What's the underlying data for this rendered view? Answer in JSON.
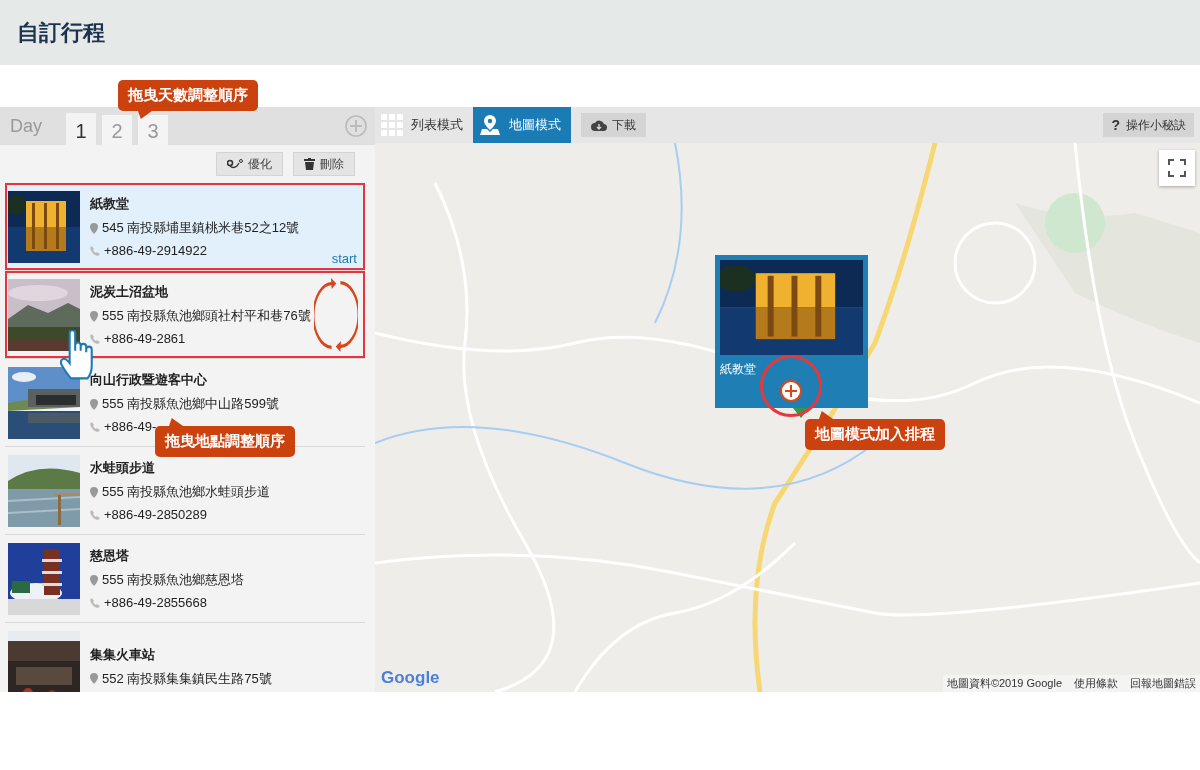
{
  "header": {
    "title": "自訂行程"
  },
  "days": {
    "label": "Day",
    "tabs": [
      {
        "label": "1",
        "selected": true
      },
      {
        "label": "2",
        "selected": false
      },
      {
        "label": "3",
        "selected": false
      }
    ]
  },
  "list_tools": [
    {
      "kind": "optimize",
      "label": "優化"
    },
    {
      "kind": "delete",
      "label": "刪除"
    }
  ],
  "places": [
    {
      "name": "紙教堂",
      "address": "545 南投縣埔里鎮桃米巷52之12號",
      "phone": "+886-49-2914922",
      "selected": true,
      "highlighted": true,
      "badge": "start"
    },
    {
      "name": "泥炭土沼盆地",
      "address": "555 南投縣魚池鄉頭社村平和巷76號",
      "phone": "+886-49-2861",
      "selected": false,
      "highlighted": true
    },
    {
      "name": "向山行政暨遊客中心",
      "address": "555 南投縣魚池鄉中山路599號",
      "phone": "+886-49-",
      "selected": false,
      "highlighted": false
    },
    {
      "name": "水蛙頭步道",
      "address": "555 南投縣魚池鄉水蛙頭步道",
      "phone": "+886-49-2850289",
      "selected": false,
      "highlighted": false
    },
    {
      "name": "慈恩塔",
      "address": "555 南投縣魚池鄉慈恩塔",
      "phone": "+886-49-2855668",
      "selected": false,
      "highlighted": false
    },
    {
      "name": "集集火車站",
      "address": "552 南投縣集集鎮民生路75號",
      "selected": false,
      "highlighted": false
    }
  ],
  "map": {
    "modes": [
      {
        "kind": "list",
        "label": "列表模式",
        "selected": false
      },
      {
        "kind": "map",
        "label": "地圖模式",
        "selected": true
      }
    ],
    "download": "下載",
    "tips_icon": "?",
    "tips": "操作小秘訣",
    "popup": {
      "name": "紙教堂"
    },
    "logo": "Google",
    "attribution": [
      "地圖資料©2019 Google",
      "使用條款",
      "回報地圖錯誤"
    ]
  },
  "annotations": [
    {
      "kind": "drag-days",
      "text": "拖曳天數調整順序"
    },
    {
      "kind": "drag-places",
      "text": "拖曳地點調整順序"
    },
    {
      "kind": "add-from-map",
      "text": "地圖模式加入排程"
    }
  ]
}
